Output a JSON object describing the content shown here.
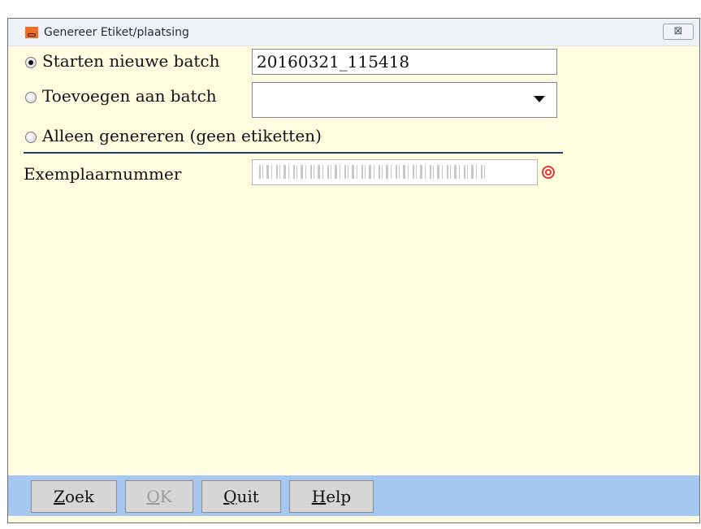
{
  "window": {
    "title": "Genereer Etiket/plaatsing",
    "close_glyph": "⊠"
  },
  "options": [
    {
      "label": "Starten nieuwe batch",
      "checked": true,
      "value": "20160321_115418"
    },
    {
      "label": "Toevoegen aan batch",
      "checked": false,
      "value": ""
    },
    {
      "label": "Alleen genereren (geen etiketten)",
      "checked": false
    }
  ],
  "exemplaar": {
    "label": "Exemplaarnummer",
    "icon": "barcode-icon",
    "target_icon": "target-icon"
  },
  "buttons": [
    {
      "label": "Zoek",
      "mnemonic": "Z",
      "rest": "oek",
      "disabled": false
    },
    {
      "label": "OK",
      "mnemonic": "O",
      "rest": "K",
      "disabled": true
    },
    {
      "label": "Quit",
      "mnemonic": "Q",
      "rest": "uit",
      "disabled": false
    },
    {
      "label": "Help",
      "mnemonic": "H",
      "rest": "elp",
      "disabled": false
    }
  ],
  "colors": {
    "form_background": "#fffde0",
    "footer": "#a6c8f0",
    "divider": "#1d3d6a",
    "target": "#e03a3a"
  }
}
